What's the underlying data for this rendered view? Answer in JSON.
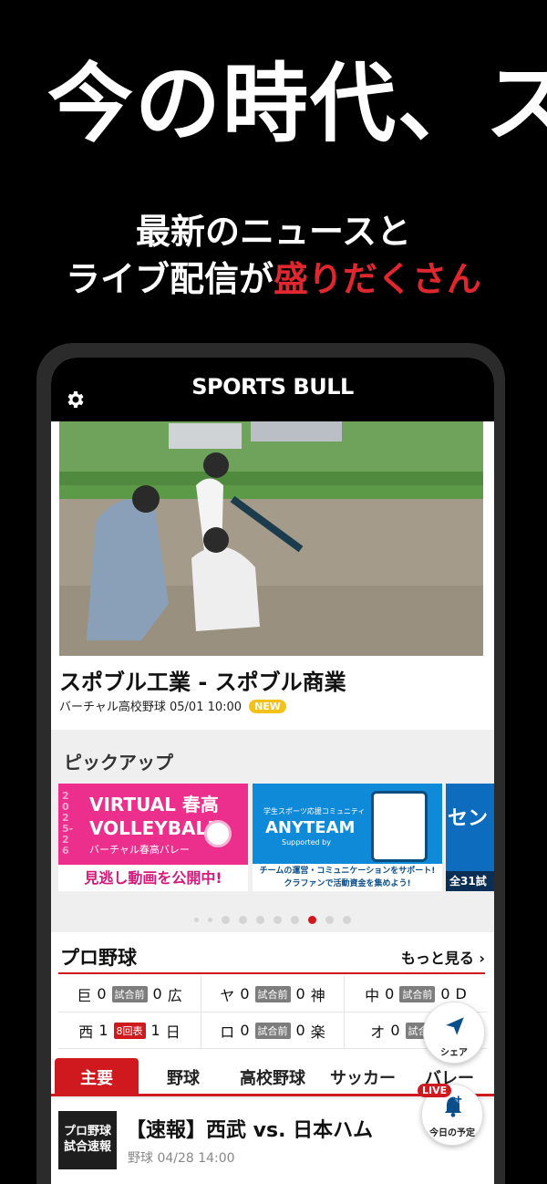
{
  "promo": {
    "headline": "今の時代、ス",
    "sub_line1": "最新のニュースと",
    "sub_line2_prefix": "ライブ配信が",
    "sub_line2_accent": "盛りだくさん"
  },
  "app": {
    "logo": "SPORTS BULL",
    "settings_icon": "gear-icon"
  },
  "hero": {
    "title": "スポブル工業 - スポブル商業",
    "meta": "バーチャル高校野球  05/01  10:00",
    "badge": "NEW"
  },
  "pickup": {
    "title": "ピックアップ",
    "banners": [
      {
        "title": "VIRTUAL 春高 VOLLEYBALL",
        "subtitle": "バーチャル春高バレー",
        "caption": "見逃し動画を公開中!",
        "year": "2025-26"
      },
      {
        "small": "学生スポーツ応援コミュニティ",
        "title": "ANYTEAM",
        "supported": "Supported by",
        "caption1": "チームの運営・コミュニケーションをサポート!",
        "caption2": "クラファンで活動資金を集めよう!"
      },
      {
        "title": "セン",
        "caption": "全31試"
      }
    ],
    "dots_total": 10,
    "dots_active": 7
  },
  "pro_baseball": {
    "title": "プロ野球",
    "more": "もっと見る ›",
    "games": [
      [
        {
          "home": "巨",
          "hs": "0",
          "status": "試合前",
          "as": "0",
          "away": "広",
          "live": false
        },
        {
          "home": "ヤ",
          "hs": "0",
          "status": "試合前",
          "as": "0",
          "away": "神",
          "live": false
        },
        {
          "home": "中",
          "hs": "0",
          "status": "試合前",
          "as": "0",
          "away": "D",
          "live": false
        }
      ],
      [
        {
          "home": "西",
          "hs": "1",
          "status": "8回表",
          "as": "1",
          "away": "日",
          "live": true
        },
        {
          "home": "ロ",
          "hs": "0",
          "status": "試合前",
          "as": "0",
          "away": "楽",
          "live": false
        },
        {
          "home": "オ",
          "hs": "0",
          "status": "試合前",
          "as": "0",
          "away": "",
          "live": false
        }
      ]
    ]
  },
  "tabs": [
    "主要",
    "野球",
    "高校野球",
    "サッカー",
    "バレー"
  ],
  "news": {
    "thumb_line1": "プロ野球",
    "thumb_line2": "試合速報",
    "title": "【速報】西武 vs. 日本ハム",
    "meta": "野球  04/28 14:00"
  },
  "fabs": {
    "share_label": "シェア",
    "schedule_label": "今日の予定",
    "live_tag": "LIVE"
  },
  "colors": {
    "accent_red": "#d0191f",
    "new_badge": "#f2c21b",
    "app_bar": "#000000"
  }
}
